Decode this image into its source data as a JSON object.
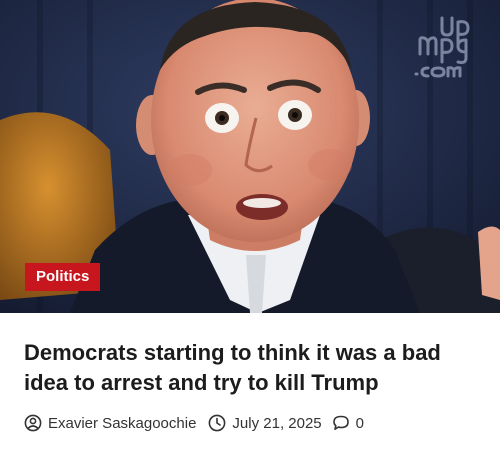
{
  "article": {
    "category": "Politics",
    "title": "Democrats starting to think it was a bad idea to arrest and try to kill Trump",
    "author": "Exavier Saskagoochie",
    "date": "July 21, 2025",
    "comments": "0"
  },
  "image": {
    "watermark_text": "upmpg.com",
    "description_icon": "photo-of-man-with-surprised-expression"
  },
  "icons": {
    "author": "user-circle-icon",
    "date": "clock-icon",
    "comments": "comment-bubble-icon"
  },
  "colors": {
    "badge_bg": "#c8161e",
    "badge_text": "#ffffff",
    "title_text": "#1c1c1c",
    "meta_text": "#333333"
  }
}
